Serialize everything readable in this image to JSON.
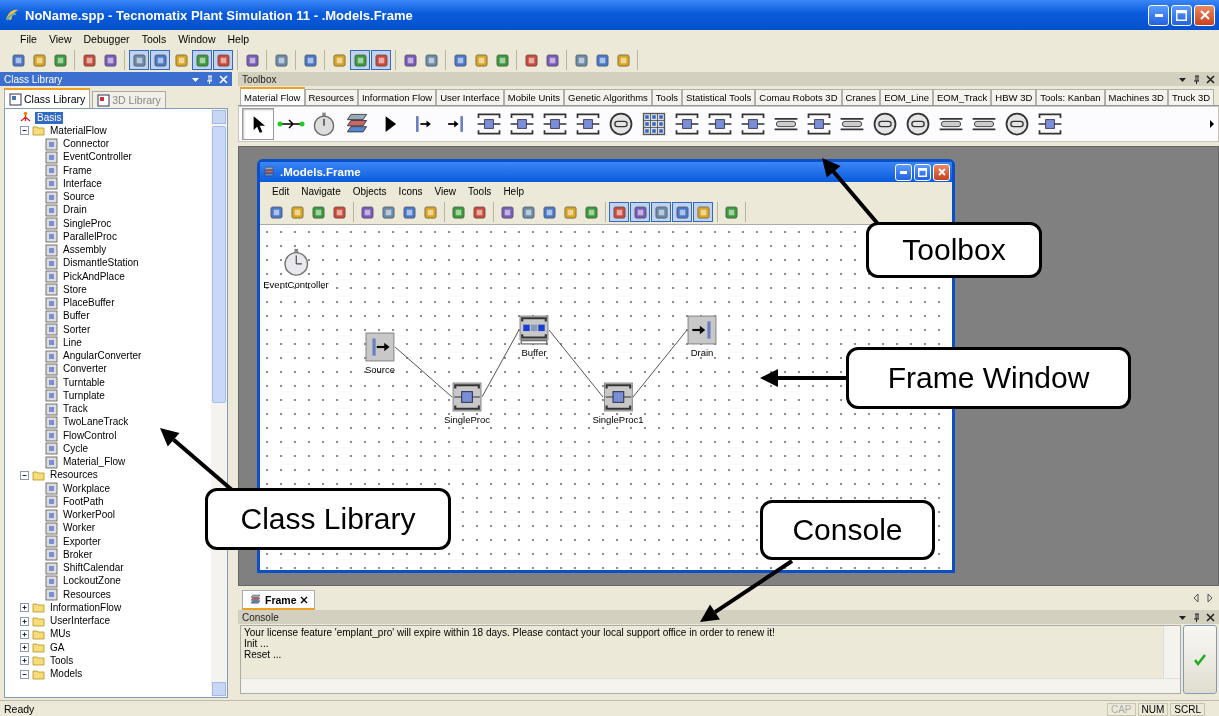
{
  "window": {
    "title": "NoName.spp - Tecnomatix Plant Simulation 11 - .Models.Frame"
  },
  "menu": [
    "File",
    "View",
    "Debugger",
    "Tools",
    "Window",
    "Help"
  ],
  "toolbar": [
    {
      "buttons": [
        {
          "pressed": false
        },
        {
          "pressed": false
        },
        {
          "pressed": false
        }
      ]
    },
    {
      "buttons": [
        {
          "pressed": false
        },
        {
          "pressed": false
        }
      ]
    },
    {
      "buttons": [
        {
          "pressed": true
        },
        {
          "pressed": true
        },
        {
          "pressed": false
        },
        {
          "pressed": true
        },
        {
          "pressed": true
        }
      ]
    },
    {
      "buttons": [
        {
          "pressed": false
        }
      ]
    },
    {
      "buttons": [
        {
          "pressed": false
        }
      ]
    },
    {
      "buttons": [
        {
          "pressed": false
        }
      ]
    },
    {
      "buttons": [
        {
          "pressed": false
        },
        {
          "pressed": true
        },
        {
          "pressed": true
        }
      ]
    },
    {
      "buttons": [
        {
          "pressed": false
        },
        {
          "pressed": false
        }
      ]
    },
    {
      "buttons": [
        {
          "pressed": false
        },
        {
          "pressed": false
        },
        {
          "pressed": false
        }
      ]
    },
    {
      "buttons": [
        {
          "pressed": false
        },
        {
          "pressed": false
        }
      ]
    },
    {
      "buttons": [
        {
          "pressed": false
        },
        {
          "pressed": false
        },
        {
          "pressed": false
        }
      ]
    }
  ],
  "class_library": {
    "title": "Class Library",
    "active": true,
    "tabs": [
      {
        "label": "Class Library",
        "selected": true
      },
      {
        "label": "3D Library",
        "selected": false
      }
    ],
    "tree": [
      {
        "label": "Basis",
        "kind": "root",
        "selected": true,
        "children": [
          {
            "label": "MaterialFlow",
            "kind": "folder",
            "expanded": true,
            "selected": false,
            "children": [
              {
                "label": "Connector",
                "kind": "class",
                "selected": false
              },
              {
                "label": "EventController",
                "kind": "class",
                "selected": false
              },
              {
                "label": "Frame",
                "kind": "class",
                "selected": false
              },
              {
                "label": "Interface",
                "kind": "class",
                "selected": false
              },
              {
                "label": "Source",
                "kind": "class",
                "selected": false
              },
              {
                "label": "Drain",
                "kind": "class",
                "selected": false
              },
              {
                "label": "SingleProc",
                "kind": "class",
                "selected": false
              },
              {
                "label": "ParallelProc",
                "kind": "class",
                "selected": false
              },
              {
                "label": "Assembly",
                "kind": "class",
                "selected": false
              },
              {
                "label": "DismantleStation",
                "kind": "class",
                "selected": false
              },
              {
                "label": "PickAndPlace",
                "kind": "class",
                "selected": false
              },
              {
                "label": "Store",
                "kind": "class",
                "selected": false
              },
              {
                "label": "PlaceBuffer",
                "kind": "class",
                "selected": false
              },
              {
                "label": "Buffer",
                "kind": "class",
                "selected": false
              },
              {
                "label": "Sorter",
                "kind": "class",
                "selected": false
              },
              {
                "label": "Line",
                "kind": "class",
                "selected": false
              },
              {
                "label": "AngularConverter",
                "kind": "class",
                "selected": false
              },
              {
                "label": "Converter",
                "kind": "class",
                "selected": false
              },
              {
                "label": "Turntable",
                "kind": "class",
                "selected": false
              },
              {
                "label": "Turnplate",
                "kind": "class",
                "selected": false
              },
              {
                "label": "Track",
                "kind": "class",
                "selected": false
              },
              {
                "label": "TwoLaneTrack",
                "kind": "class",
                "selected": false
              },
              {
                "label": "FlowControl",
                "kind": "class",
                "selected": false
              },
              {
                "label": "Cycle",
                "kind": "class",
                "selected": false
              },
              {
                "label": "Material_Flow",
                "kind": "class",
                "selected": false
              }
            ]
          },
          {
            "label": "Resources",
            "kind": "folder",
            "expanded": true,
            "selected": false,
            "children": [
              {
                "label": "Workplace",
                "kind": "class",
                "selected": false
              },
              {
                "label": "FootPath",
                "kind": "class",
                "selected": false
              },
              {
                "label": "WorkerPool",
                "kind": "class",
                "selected": false
              },
              {
                "label": "Worker",
                "kind": "class",
                "selected": false
              },
              {
                "label": "Exporter",
                "kind": "class",
                "selected": false
              },
              {
                "label": "Broker",
                "kind": "class",
                "selected": false
              },
              {
                "label": "ShiftCalendar",
                "kind": "class",
                "selected": false
              },
              {
                "label": "LockoutZone",
                "kind": "class",
                "selected": false
              },
              {
                "label": "Resources",
                "kind": "class",
                "selected": false
              }
            ]
          },
          {
            "label": "InformationFlow",
            "kind": "folder",
            "expanded": false,
            "selected": false
          },
          {
            "label": "UserInterface",
            "kind": "folder",
            "expanded": false,
            "selected": false
          },
          {
            "label": "MUs",
            "kind": "folder",
            "expanded": false,
            "selected": false
          },
          {
            "label": "GA",
            "kind": "folder",
            "expanded": false,
            "selected": false
          },
          {
            "label": "Tools",
            "kind": "folder",
            "expanded": false,
            "selected": false
          },
          {
            "label": "Models",
            "kind": "folder",
            "expanded": true,
            "selected": false
          }
        ]
      }
    ]
  },
  "toolbox": {
    "title": "Toolbox",
    "active": false,
    "tabs": [
      {
        "label": "Material Flow",
        "selected": true
      },
      {
        "label": "Resources",
        "selected": false
      },
      {
        "label": "Information Flow",
        "selected": false
      },
      {
        "label": "User Interface",
        "selected": false
      },
      {
        "label": "Mobile Units",
        "selected": false
      },
      {
        "label": "Genetic Algorithms",
        "selected": false
      },
      {
        "label": "Tools",
        "selected": false
      },
      {
        "label": "Statistical Tools",
        "selected": false
      },
      {
        "label": "Comau Robots 3D",
        "selected": false
      },
      {
        "label": "Cranes",
        "selected": false
      },
      {
        "label": "EOM_Line",
        "selected": false
      },
      {
        "label": "EOM_Track",
        "selected": false
      },
      {
        "label": "HBW 3D",
        "selected": false
      },
      {
        "label": "Tools: Kanban",
        "selected": false
      },
      {
        "label": "Machines 3D",
        "selected": false
      },
      {
        "label": "Truck 3D",
        "selected": false
      }
    ],
    "tools": [
      {
        "selected": true
      },
      {
        "selected": false
      },
      {
        "selected": false
      },
      {
        "selected": false
      },
      {
        "selected": false
      },
      {
        "selected": false
      },
      {
        "selected": false
      },
      {
        "selected": false
      },
      {
        "selected": false
      },
      {
        "selected": false
      },
      {
        "selected": false
      },
      {
        "selected": false
      },
      {
        "selected": false
      },
      {
        "selected": false
      },
      {
        "selected": false
      },
      {
        "selected": false
      },
      {
        "selected": false
      },
      {
        "selected": false
      },
      {
        "selected": false
      },
      {
        "selected": false
      },
      {
        "selected": false
      },
      {
        "selected": false
      },
      {
        "selected": false
      },
      {
        "selected": false
      },
      {
        "selected": false
      }
    ]
  },
  "frame_window": {
    "title": ".Models.Frame",
    "menu": [
      "Edit",
      "Navigate",
      "Objects",
      "Icons",
      "View",
      "Tools",
      "Help"
    ],
    "toolbar": [
      {
        "buttons": [
          {
            "pressed": false
          },
          {
            "pressed": false
          },
          {
            "pressed": false
          },
          {
            "pressed": false
          }
        ]
      },
      {
        "buttons": [
          {
            "pressed": false
          },
          {
            "pressed": false
          },
          {
            "pressed": false
          },
          {
            "pressed": false
          }
        ]
      },
      {
        "buttons": [
          {
            "pressed": false
          },
          {
            "pressed": false
          }
        ]
      },
      {
        "buttons": [
          {
            "pressed": false
          },
          {
            "pressed": false
          },
          {
            "pressed": false
          },
          {
            "pressed": false
          },
          {
            "pressed": false
          }
        ]
      },
      {
        "buttons": [
          {
            "pressed": true
          },
          {
            "pressed": true
          },
          {
            "pressed": true
          },
          {
            "pressed": true
          },
          {
            "pressed": true
          }
        ]
      },
      {
        "buttons": [
          {
            "pressed": false
          }
        ]
      }
    ],
    "nodes": [
      {
        "kind": "controller",
        "label": "EventController"
      },
      {
        "kind": "source",
        "label": "Source"
      },
      {
        "kind": "station",
        "label": "SingleProc"
      },
      {
        "kind": "buffer",
        "label": "Buffer"
      },
      {
        "kind": "station",
        "label": "SingleProc1"
      },
      {
        "kind": "drain",
        "label": "Drain"
      }
    ]
  },
  "document_tabs": [
    {
      "label": "Frame",
      "selected": true
    }
  ],
  "console": {
    "title": "Console",
    "active": false,
    "lines": [
      "Your license feature 'emplant_pro' will expire within 18 days. Please contact your local support office in order to renew it!",
      "Init ...",
      "Reset ..."
    ]
  },
  "status_bar": {
    "message": "Ready",
    "indicators": [
      {
        "label": "CAP",
        "on": false
      },
      {
        "label": "NUM",
        "on": true
      },
      {
        "label": "SCRL",
        "on": true
      }
    ]
  },
  "callouts": [
    {
      "label": "Toolbox"
    },
    {
      "label": "Frame Window"
    },
    {
      "label": "Class Library"
    },
    {
      "label": "Console"
    }
  ]
}
